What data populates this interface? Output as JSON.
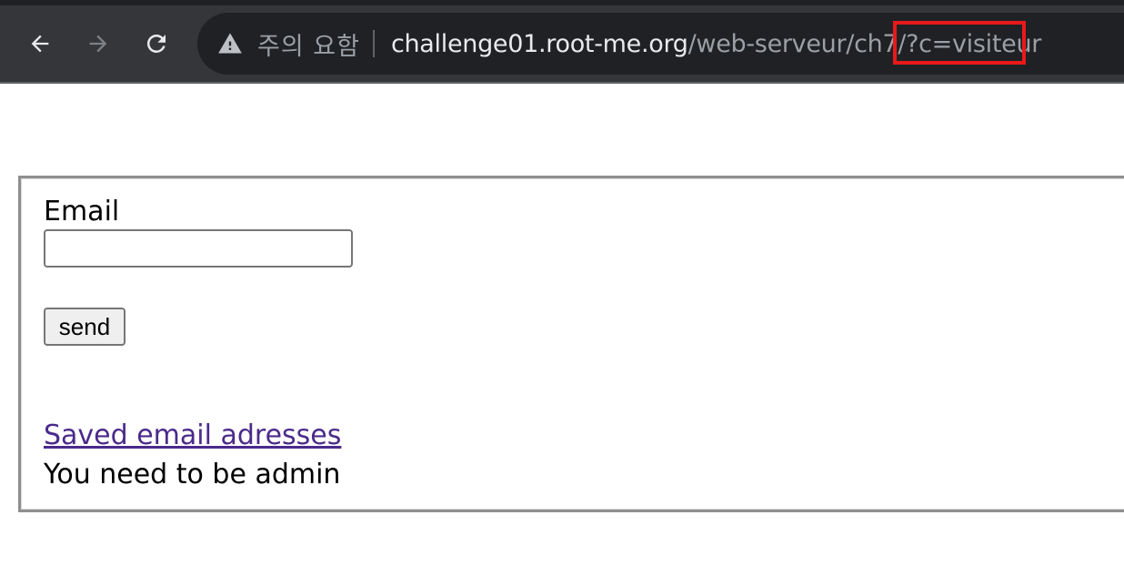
{
  "browser": {
    "back_label": "Back",
    "forward_label": "Forward",
    "reload_label": "Reload",
    "security_text": "주의 요함",
    "url": {
      "host": "challenge01.root-me.org",
      "path": "/web-serveur/ch7/",
      "query": "?c=visiteur"
    },
    "highlight_color": "#e8191b"
  },
  "page": {
    "email_label": "Email",
    "email_value": "",
    "send_label": "send",
    "saved_link": "Saved email adresses",
    "admin_message": "You need to be admin",
    "link_color": "#4b2a8a"
  }
}
